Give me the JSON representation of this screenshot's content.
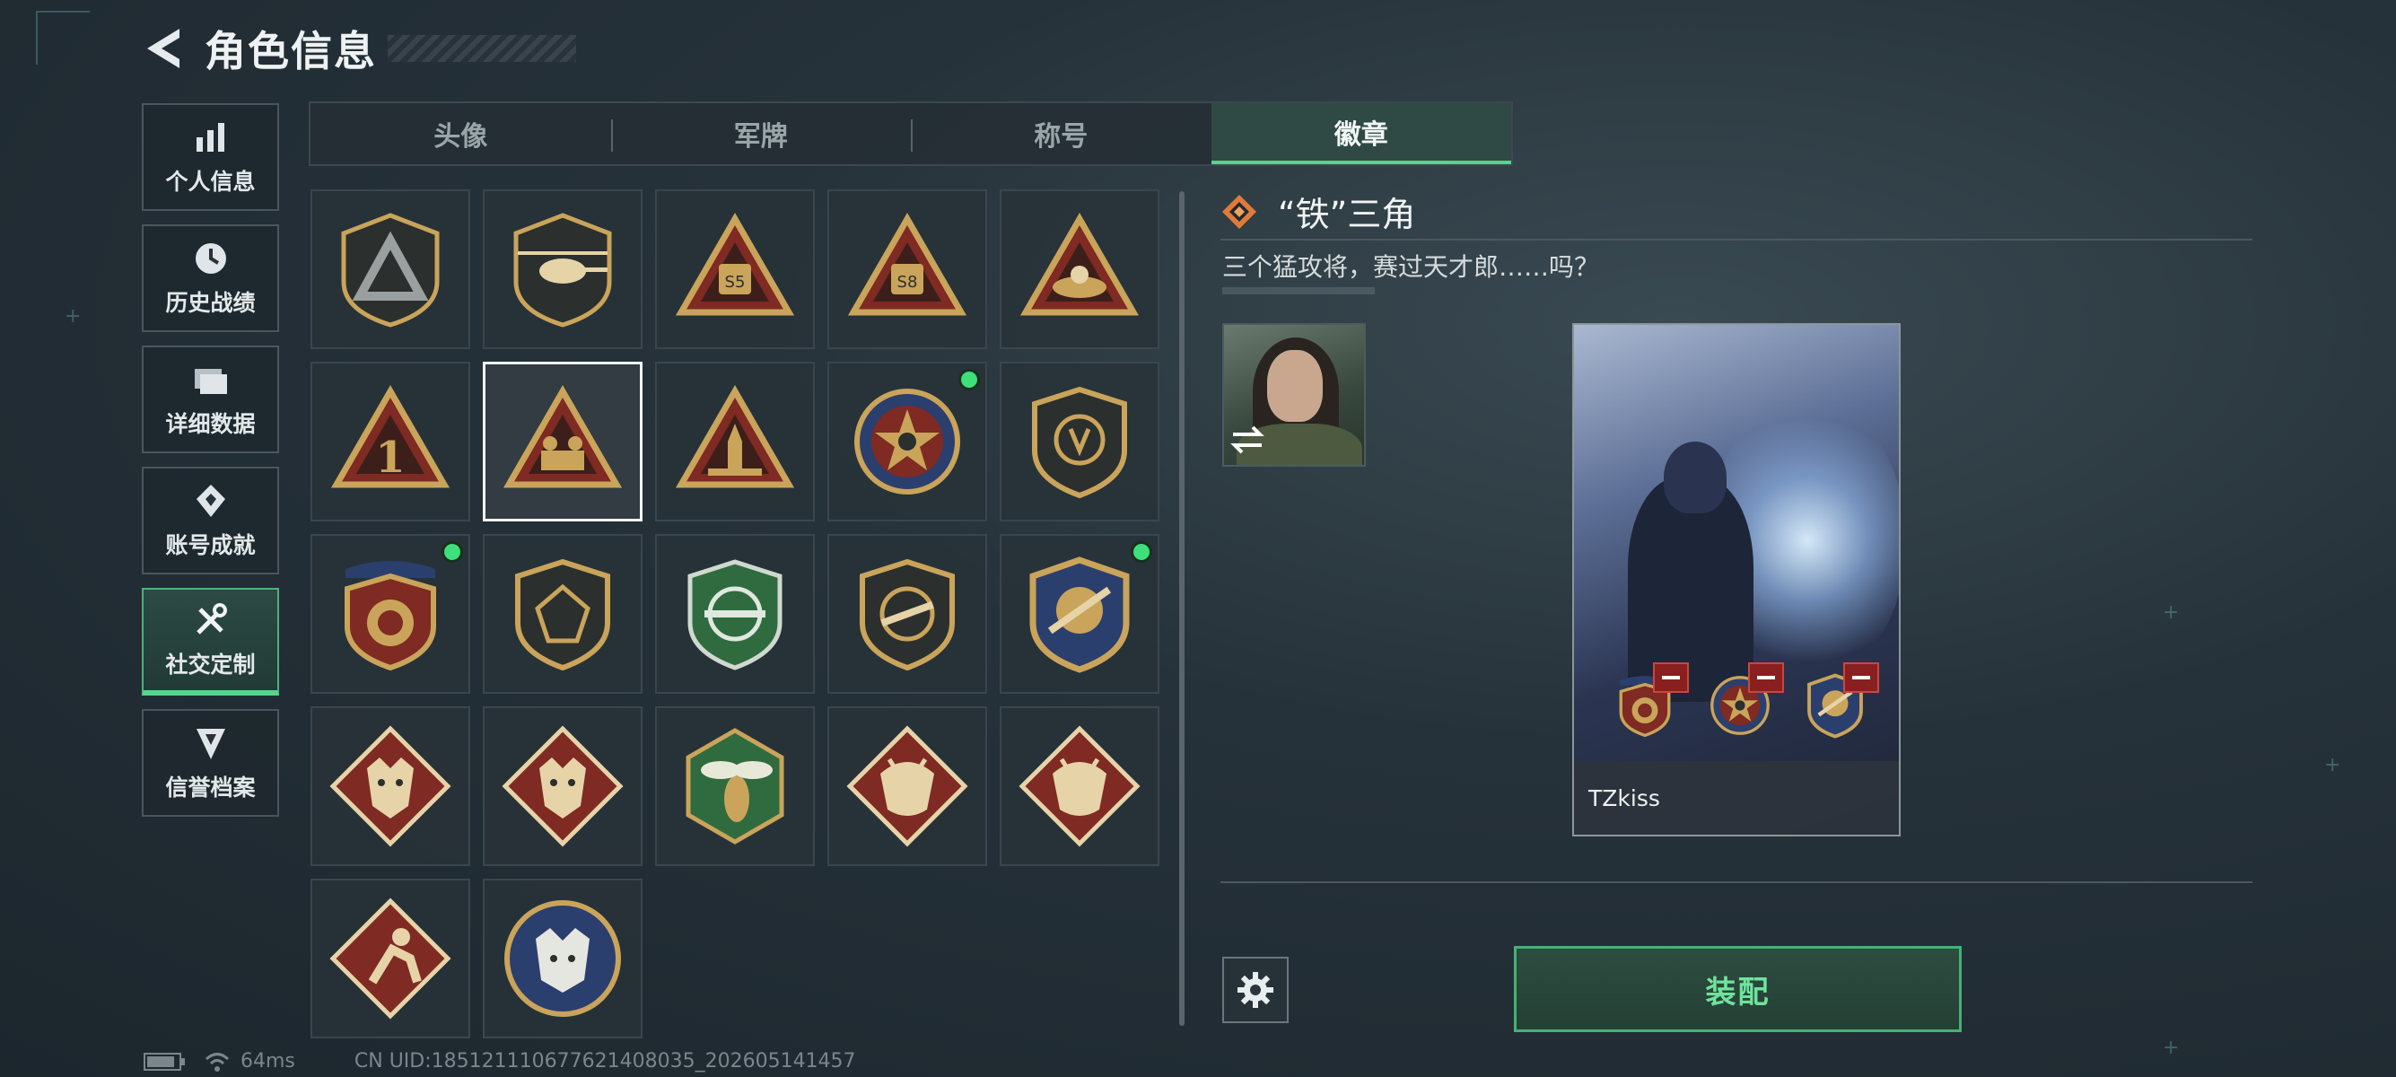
{
  "header": {
    "title": "角色信息"
  },
  "sidebar": {
    "items": [
      {
        "label": "个人信息",
        "icon": "bar-chart-icon",
        "active": false
      },
      {
        "label": "历史战绩",
        "icon": "clock-icon",
        "active": false
      },
      {
        "label": "详细数据",
        "icon": "folder-icon",
        "active": false
      },
      {
        "label": "账号成就",
        "icon": "achievement-icon",
        "active": false
      },
      {
        "label": "社交定制",
        "icon": "tools-icon",
        "active": true
      },
      {
        "label": "信誉档案",
        "icon": "reputation-icon",
        "active": false
      }
    ]
  },
  "tabs": [
    {
      "label": "头像",
      "active": false
    },
    {
      "label": "军牌",
      "active": false
    },
    {
      "label": "称号",
      "active": false
    },
    {
      "label": "徽章",
      "active": true
    }
  ],
  "badges": [
    {
      "icon": "triangle-shield-badge-icon",
      "new": false,
      "selected": false
    },
    {
      "icon": "helicopter-badge-icon",
      "new": false,
      "selected": false
    },
    {
      "icon": "s5-triangle-badge-icon",
      "new": false,
      "selected": false
    },
    {
      "icon": "s8-triangle-badge-icon",
      "new": false,
      "selected": false
    },
    {
      "icon": "nest-triangle-badge-icon",
      "new": false,
      "selected": false
    },
    {
      "icon": "number-one-triangle-badge-icon",
      "new": false,
      "selected": false
    },
    {
      "icon": "soldiers-triangle-badge-icon",
      "new": false,
      "selected": true
    },
    {
      "icon": "rocket-triangle-badge-icon",
      "new": false,
      "selected": false
    },
    {
      "icon": "star-emblem-badge-icon",
      "new": true,
      "selected": false
    },
    {
      "icon": "dark-shield-badge-icon",
      "new": false,
      "selected": false
    },
    {
      "icon": "red-gold-shield-badge-icon",
      "new": true,
      "selected": false
    },
    {
      "icon": "gem-shield-badge-icon",
      "new": false,
      "selected": false
    },
    {
      "icon": "green-crosshair-badge-icon",
      "new": false,
      "selected": false
    },
    {
      "icon": "crossed-gun-badge-icon",
      "new": false,
      "selected": false
    },
    {
      "icon": "blue-gold-sword-badge-icon",
      "new": true,
      "selected": false
    },
    {
      "icon": "wolf-diamond-badge-icon",
      "new": false,
      "selected": false
    },
    {
      "icon": "wolf-diamond-badge-icon",
      "new": false,
      "selected": false
    },
    {
      "icon": "wasp-hexagon-badge-icon",
      "new": false,
      "selected": false
    },
    {
      "icon": "dragon-diamond-badge-icon",
      "new": false,
      "selected": false
    },
    {
      "icon": "dragon-diamond-badge-icon",
      "new": false,
      "selected": false
    },
    {
      "icon": "runner-diamond-badge-icon",
      "new": false,
      "selected": false
    },
    {
      "icon": "lynx-circle-badge-icon",
      "new": false,
      "selected": false
    }
  ],
  "detail": {
    "name": "“铁”三角",
    "description": "三个猛攻将，赛过天才郎……吗？",
    "player_name": "TZkiss",
    "equip_label": "装配",
    "card_badges": [
      "red-gold-shield-badge-icon",
      "star-emblem-badge-icon",
      "blue-gold-sword-badge-icon"
    ]
  },
  "status": {
    "ping": "64ms",
    "uid": "CN UID:185121110677621408035_202605141457"
  },
  "colors": {
    "accent_green": "#56d38e",
    "new_dot": "#3ee07a",
    "badge_gold": "#c9a45a",
    "badge_red": "#7f2a22"
  }
}
